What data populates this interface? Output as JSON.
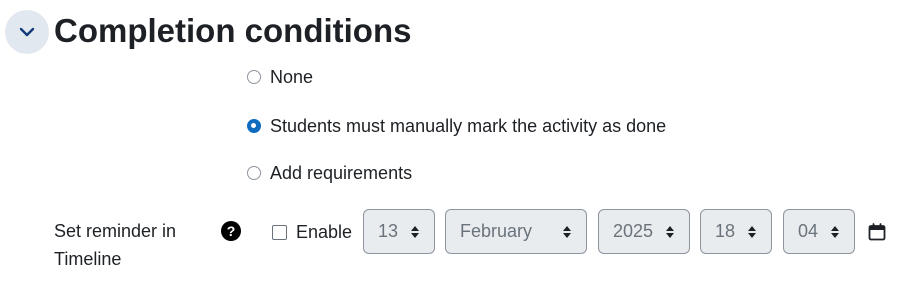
{
  "section": {
    "title": "Completion conditions",
    "collapse_icon": "chevron-down-icon"
  },
  "completion": {
    "options": [
      {
        "label": "None",
        "checked": false
      },
      {
        "label": "Students must manually mark the activity as done",
        "checked": true
      },
      {
        "label": "Add requirements",
        "checked": false
      }
    ]
  },
  "reminder": {
    "label": "Set reminder in Timeline",
    "help_icon": "question-circle-icon",
    "help_glyph": "?",
    "enable_label": "Enable",
    "enabled": false,
    "day": "13",
    "month": "February",
    "year": "2025",
    "hour": "18",
    "minute": "04",
    "calendar_icon": "calendar-icon"
  }
}
